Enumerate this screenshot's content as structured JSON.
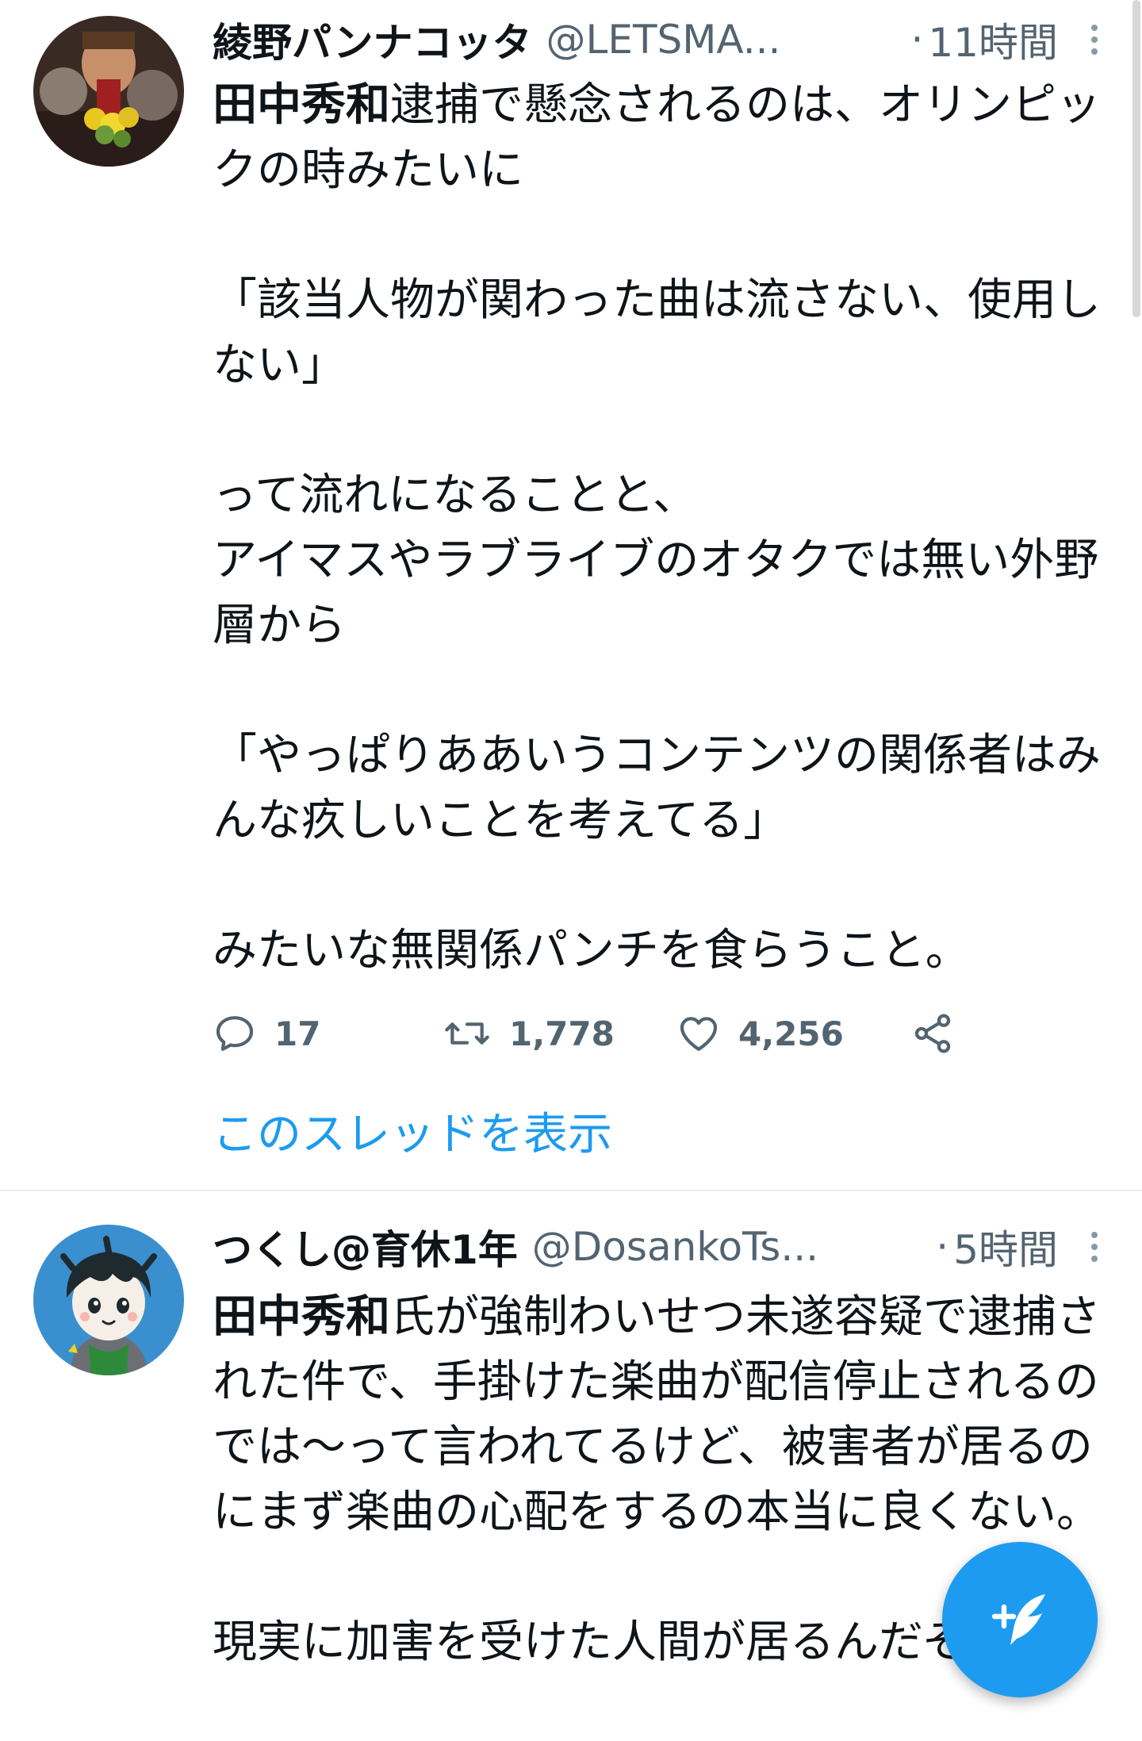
{
  "tweets": [
    {
      "display_name": "綾野パンナコッタ",
      "handle": "@LETSMA...",
      "separator": "·",
      "time": "11時間",
      "body_bold": "田中秀和",
      "body_rest": "逮捕で懸念されるのは、オリンピックの時みたいに\n\n「該当人物が関わった曲は流さない、使用しない」\n\nって流れになることと、\nアイマスやラブライブのオタクでは無い外野層から\n\n「やっぱりああいうコンテンツの関係者はみんな疚しいことを考えてる」\n\nみたいな無関係パンチを食らうこと。",
      "reply_count": "17",
      "retweet_count": "1,778",
      "like_count": "4,256",
      "thread_link": "このスレッドを表示"
    },
    {
      "display_name": "つくし@育休1年",
      "handle": "@DosankoTs...",
      "separator": "·",
      "time": "5時間",
      "body_bold": "田中秀和",
      "body_rest": "氏が強制わいせつ未遂容疑で逮捕された件で、手掛けた楽曲が配信停止されるのでは〜って言われてるけど、被害者が居るのにまず楽曲の心配をするの本当に良くない。\n\n現実に加害を受けた人間が居るんだぞ..."
    }
  ],
  "icons": {
    "reply": "reply-icon",
    "retweet": "retweet-icon",
    "like": "heart-icon",
    "share": "share-icon",
    "more": "more-vertical-icon",
    "compose": "compose-tweet-icon"
  },
  "colors": {
    "accent": "#1d9bf0",
    "secondary_text": "#536471",
    "primary_text": "#0f1419"
  }
}
